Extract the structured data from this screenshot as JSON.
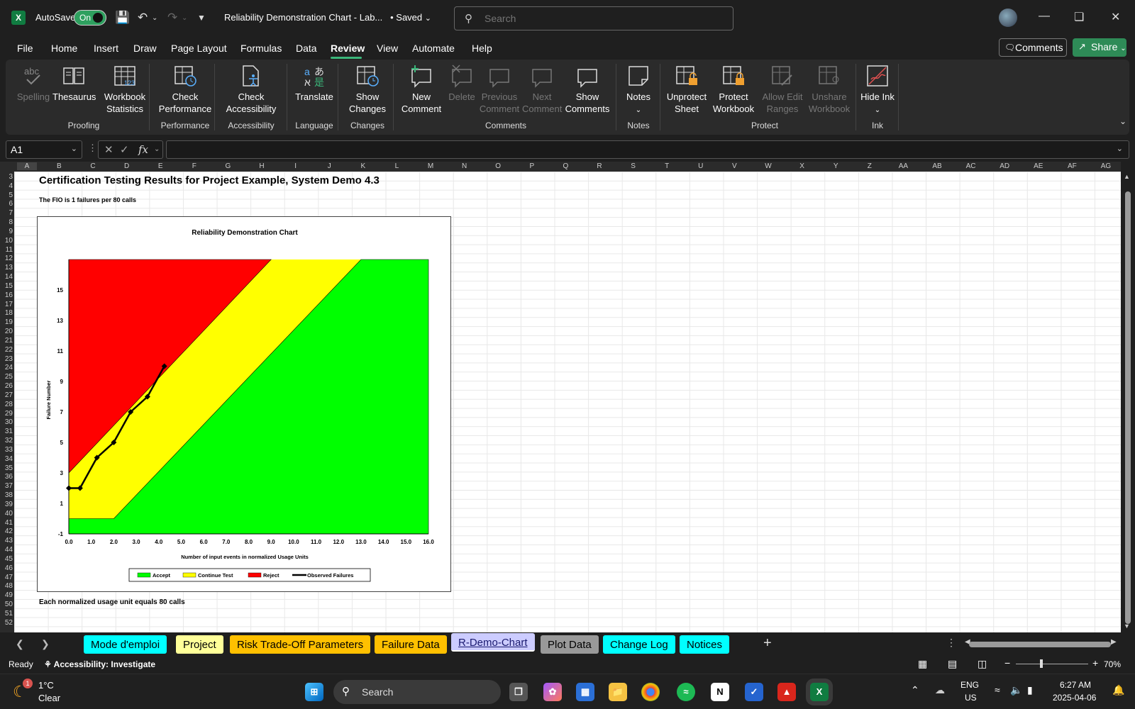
{
  "titlebar": {
    "autosave_label": "AutoSave",
    "autosave_state": "On",
    "document_title": "Reliability Demonstration Chart - Lab...",
    "saved_status": "• Saved",
    "search_placeholder": "Search"
  },
  "menu": {
    "items": [
      "File",
      "Home",
      "Insert",
      "Draw",
      "Page Layout",
      "Formulas",
      "Data",
      "Review",
      "View",
      "Automate",
      "Help"
    ],
    "active": "Review",
    "comments_label": "Comments",
    "share_label": "Share"
  },
  "ribbon": {
    "buttons": [
      {
        "label": "Spelling",
        "icon": "spelling-icon",
        "disabled": true
      },
      {
        "label": "Thesaurus",
        "icon": "thesaurus-icon",
        "disabled": false
      },
      {
        "label": "Workbook Statistics",
        "icon": "workbook-statistics-icon",
        "disabled": false
      },
      {
        "label": "Check Performance",
        "icon": "check-performance-icon",
        "disabled": false
      },
      {
        "label": "Check Accessibility",
        "icon": "check-accessibility-icon",
        "disabled": false
      },
      {
        "label": "Translate",
        "icon": "translate-icon",
        "disabled": false
      },
      {
        "label": "Show Changes",
        "icon": "show-changes-icon",
        "disabled": false
      },
      {
        "label": "New Comment",
        "icon": "new-comment-icon",
        "disabled": false
      },
      {
        "label": "Delete",
        "icon": "delete-comment-icon",
        "disabled": true
      },
      {
        "label": "Previous Comment",
        "icon": "previous-comment-icon",
        "disabled": true
      },
      {
        "label": "Next Comment",
        "icon": "next-comment-icon",
        "disabled": true
      },
      {
        "label": "Show Comments",
        "icon": "show-comments-icon",
        "disabled": false
      },
      {
        "label": "Notes",
        "icon": "notes-icon",
        "disabled": false
      },
      {
        "label": "Unprotect Sheet",
        "icon": "unprotect-sheet-icon",
        "disabled": false
      },
      {
        "label": "Protect Workbook",
        "icon": "protect-workbook-icon",
        "disabled": false
      },
      {
        "label": "Allow Edit Ranges",
        "icon": "allow-edit-ranges-icon",
        "disabled": true
      },
      {
        "label": "Unshare Workbook",
        "icon": "unshare-workbook-icon",
        "disabled": true
      },
      {
        "label": "Hide Ink",
        "icon": "hide-ink-icon",
        "disabled": false
      }
    ],
    "groups": [
      "Proofing",
      "Performance",
      "Accessibility",
      "Language",
      "Changes",
      "Comments",
      "Notes",
      "Protect",
      "Ink"
    ]
  },
  "formula_bar": {
    "name_box": "A1",
    "fx": "fx",
    "formula": ""
  },
  "grid": {
    "columns": [
      "A",
      "B",
      "C",
      "D",
      "E",
      "F",
      "G",
      "H",
      "I",
      "J",
      "K",
      "L",
      "M",
      "N",
      "O",
      "P",
      "Q",
      "R",
      "S",
      "T",
      "U",
      "V",
      "W",
      "X",
      "Y",
      "Z",
      "AA",
      "AB",
      "AC",
      "AD",
      "AE",
      "AF",
      "AG"
    ],
    "first_row": 3,
    "last_row": 52
  },
  "sheet": {
    "title": "Certification Testing Results for Project Example, System Demo 4.3",
    "fio_text": "The FIO is 1 failures per 80 calls",
    "footnote": "Each normalized usage unit equals 80 calls"
  },
  "chart_data": {
    "type": "line",
    "title": "Reliability Demonstration Chart",
    "xlabel": "Number of input events in normalized Usage Units",
    "ylabel": "Failure Number",
    "xlim": [
      0,
      16
    ],
    "ylim": [
      -1,
      17
    ],
    "x_ticks": [
      "0.0",
      "1.0",
      "2.0",
      "3.0",
      "4.0",
      "5.0",
      "6.0",
      "7.0",
      "8.0",
      "9.0",
      "10.0",
      "11.0",
      "12.0",
      "13.0",
      "14.0",
      "15.0",
      "16.0"
    ],
    "y_ticks": [
      "-1",
      "1",
      "3",
      "5",
      "7",
      "9",
      "11",
      "13",
      "15"
    ],
    "regions": [
      {
        "name": "Reject",
        "color": "#ff0000",
        "boundary_x": [
          0,
          9
        ],
        "boundary_y": [
          3,
          17
        ]
      },
      {
        "name": "Continue Test",
        "color": "#ffff00"
      },
      {
        "name": "Accept",
        "color": "#00ff00",
        "boundary_x": [
          0,
          2,
          13
        ],
        "boundary_y": [
          0,
          0,
          17
        ]
      }
    ],
    "series": [
      {
        "name": "Observed Failures",
        "color": "#000000",
        "x": [
          0,
          0.5,
          1.25,
          2.0,
          2.75,
          3.5,
          4.25
        ],
        "y": [
          2,
          2,
          4,
          5,
          7,
          8,
          10
        ]
      }
    ],
    "legend": [
      "Accept",
      "Continue Test",
      "Reject",
      "Observed Failures"
    ],
    "legend_position": "bottom"
  },
  "sheet_tabs": [
    {
      "label": "Mode d'emploi",
      "color": "#00ffff",
      "active": false
    },
    {
      "label": "Project",
      "color": "#ffff99",
      "active": false
    },
    {
      "label": "Risk Trade-Off Parameters",
      "color": "#ffc000",
      "active": false
    },
    {
      "label": "Failure Data",
      "color": "#ffc000",
      "active": false
    },
    {
      "label": "R-Demo-Chart",
      "color": "#ccccff",
      "active": true
    },
    {
      "label": "Plot Data",
      "color": "#999999",
      "active": false
    },
    {
      "label": "Change Log",
      "color": "#00ffff",
      "active": false
    },
    {
      "label": "Notices",
      "color": "#00ffff",
      "active": false
    }
  ],
  "statusbar": {
    "ready": "Ready",
    "accessibility": "Accessibility: Investigate",
    "zoom": "70%"
  },
  "taskbar": {
    "weather_temp": "1°C",
    "weather_desc": "Clear",
    "weather_badge": "1",
    "search_label": "Search",
    "lang": "ENG",
    "region": "US",
    "time": "6:27 AM",
    "date": "2025-04-06"
  }
}
